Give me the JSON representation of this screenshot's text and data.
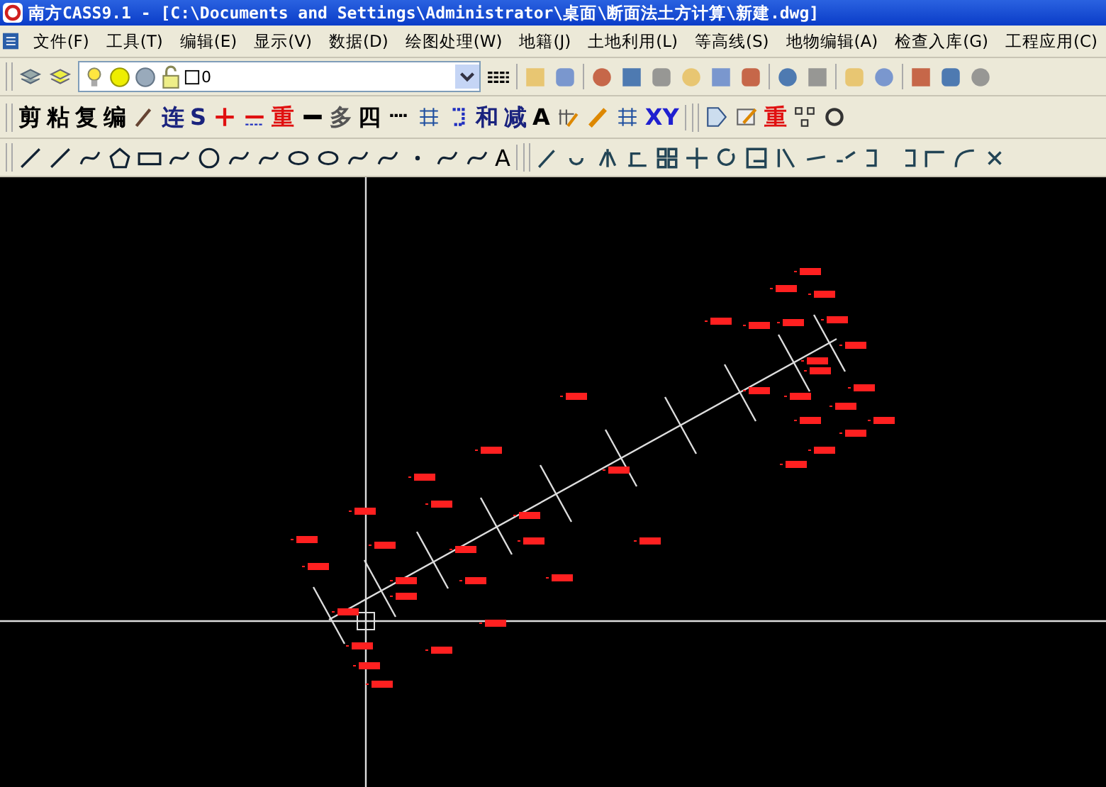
{
  "window": {
    "title": "南方CASS9.1 - [C:\\Documents and Settings\\Administrator\\桌面\\断面法土方计算\\新建.dwg]"
  },
  "menu": [
    "文件(F)",
    "工具(T)",
    "编辑(E)",
    "显示(V)",
    "数据(D)",
    "绘图处理(W)",
    "地籍(J)",
    "土地利用(L)",
    "等高线(S)",
    "地物编辑(A)",
    "检查入库(G)",
    "工程应用(C)"
  ],
  "layer_combo": {
    "value": "0"
  },
  "draw_text_tool": "A",
  "text_tools": [
    {
      "label": "剪",
      "color": "#000000"
    },
    {
      "label": "粘",
      "color": "#000000"
    },
    {
      "label": "复",
      "color": "#000000"
    },
    {
      "label": "编",
      "color": "#000000"
    },
    {
      "label": "连",
      "color": "#1a237e"
    },
    {
      "label": "S",
      "color": "#1a237e"
    },
    {
      "label": "重",
      "color": "#e01010"
    },
    {
      "label": "多",
      "color": "#555555"
    },
    {
      "label": "四",
      "color": "#000000"
    },
    {
      "label": "和",
      "color": "#1a237e"
    },
    {
      "label": "减",
      "color": "#1a237e"
    },
    {
      "label": "A",
      "color": "#000000"
    },
    {
      "label": "XY",
      "color": "#2020d0"
    },
    {
      "label": "重",
      "color": "#e01010"
    }
  ]
}
